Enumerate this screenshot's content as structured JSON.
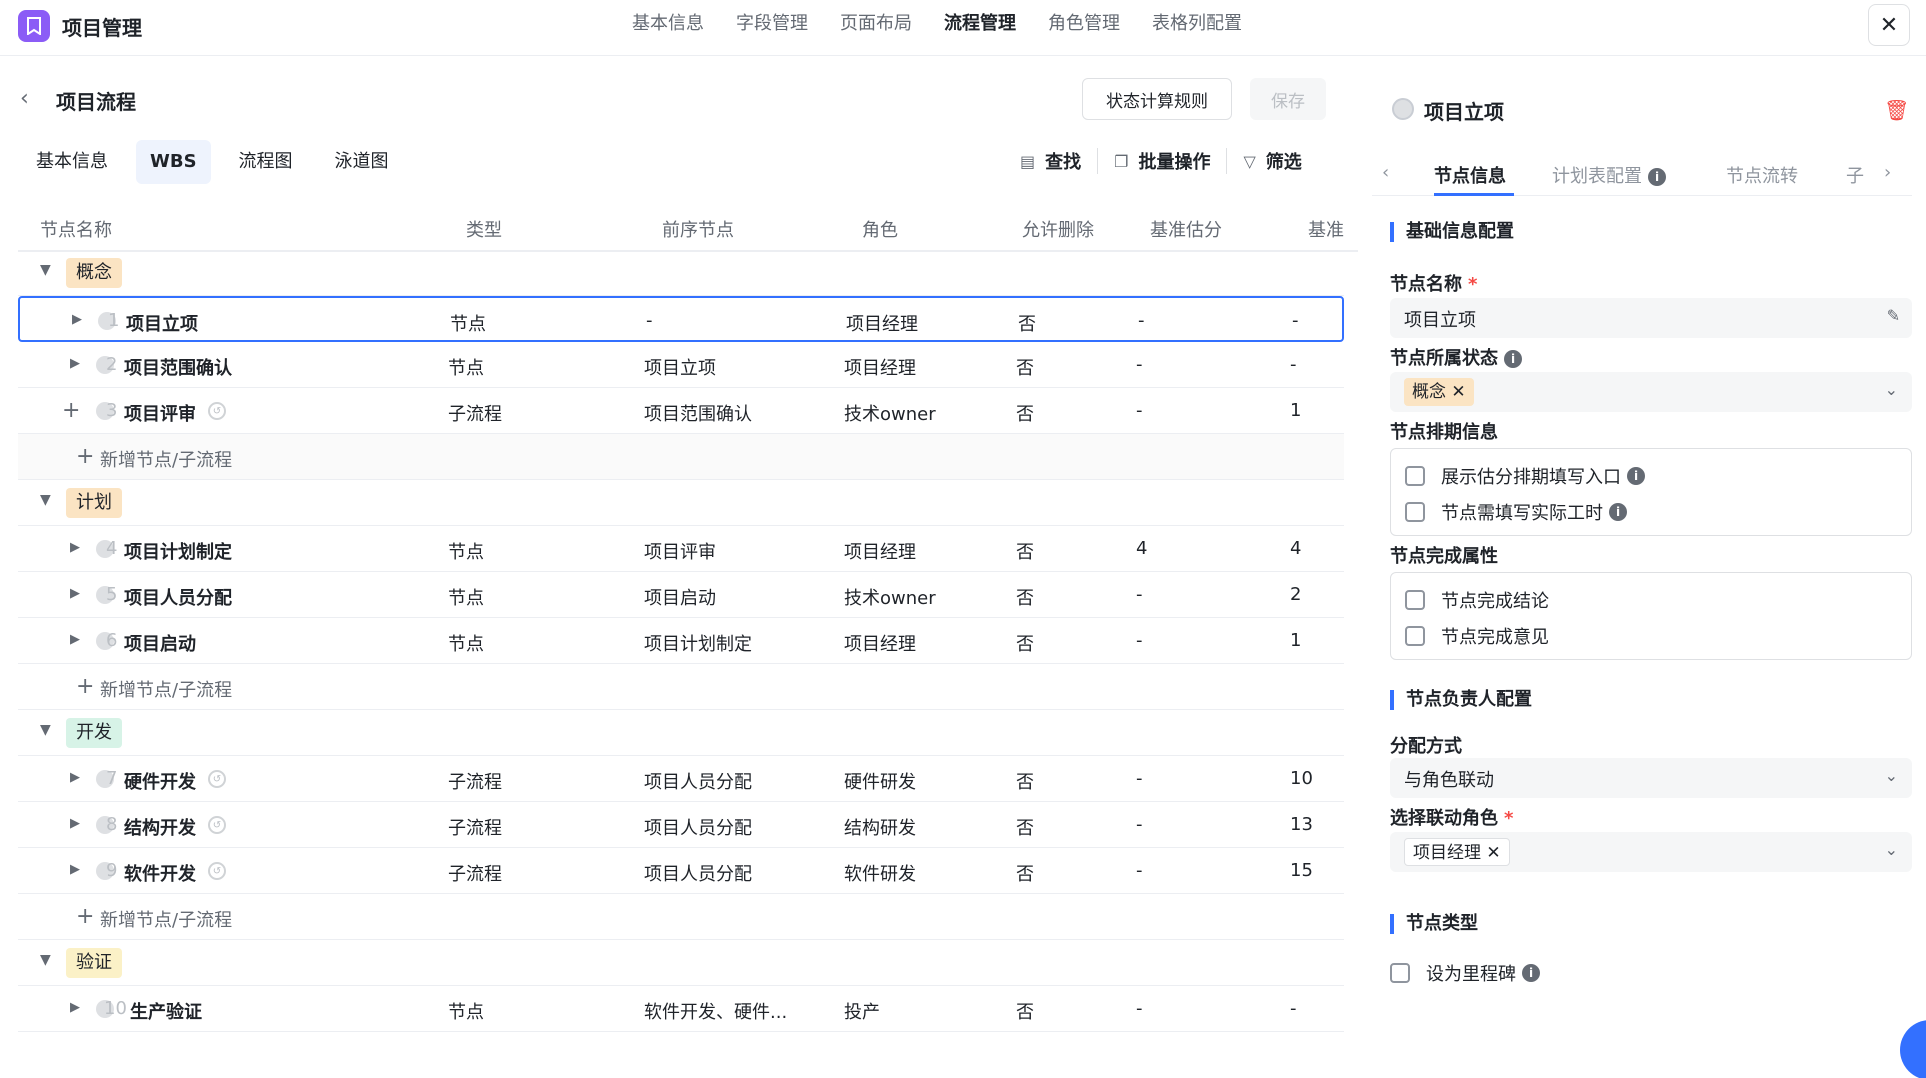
{
  "app": {
    "title": "项目管理",
    "close_label": "✕"
  },
  "topnav": [
    "基本信息",
    "字段管理",
    "页面布局",
    "流程管理",
    "角色管理",
    "表格列配置"
  ],
  "topnav_active": 3,
  "page": {
    "title": "项目流程",
    "rule_button": "状态计算规则",
    "save_button": "保存",
    "subtabs": [
      "基本信息",
      "WBS",
      "流程图",
      "泳道图"
    ],
    "subtab_active": 1,
    "tools": {
      "find": "查找",
      "batch": "批量操作",
      "filter": "筛选"
    }
  },
  "table": {
    "headers": {
      "name": "节点名称",
      "type": "类型",
      "prev": "前序节点",
      "role": "角色",
      "deletable": "允许删除",
      "estimate": "基准估分",
      "base": "基准"
    },
    "add_label": "新增节点/子流程",
    "groups": [
      {
        "label": "概念",
        "color": "#fbe4c3",
        "rows": [
          {
            "idx": "1",
            "name": "项目立项",
            "type": "节点",
            "prev": "-",
            "role": "项目经理",
            "deletable": "否",
            "estimate": "-",
            "base": "-",
            "sub": false
          },
          {
            "idx": "2",
            "name": "项目范围确认",
            "type": "节点",
            "prev": "项目立项",
            "role": "项目经理",
            "deletable": "否",
            "estimate": "-",
            "base": "-",
            "sub": false
          },
          {
            "idx": "3",
            "name": "项目评审",
            "type": "子流程",
            "prev": "项目范围确认",
            "role": "技术owner",
            "deletable": "否",
            "estimate": "-",
            "base": "1",
            "sub": true
          }
        ]
      },
      {
        "label": "计划",
        "color": "#fbe4c3",
        "rows": [
          {
            "idx": "4",
            "name": "项目计划制定",
            "type": "节点",
            "prev": "项目评审",
            "role": "项目经理",
            "deletable": "否",
            "estimate": "4",
            "base": "4",
            "sub": false
          },
          {
            "idx": "5",
            "name": "项目人员分配",
            "type": "节点",
            "prev": "项目启动",
            "role": "技术owner",
            "deletable": "否",
            "estimate": "-",
            "base": "2",
            "sub": false
          },
          {
            "idx": "6",
            "name": "项目启动",
            "type": "节点",
            "prev": "项目计划制定",
            "role": "项目经理",
            "deletable": "否",
            "estimate": "-",
            "base": "1",
            "sub": false
          }
        ]
      },
      {
        "label": "开发",
        "color": "#d7f3e7",
        "rows": [
          {
            "idx": "7",
            "name": "硬件开发",
            "type": "子流程",
            "prev": "项目人员分配",
            "role": "硬件研发",
            "deletable": "否",
            "estimate": "-",
            "base": "10",
            "sub": true
          },
          {
            "idx": "8",
            "name": "结构开发",
            "type": "子流程",
            "prev": "项目人员分配",
            "role": "结构研发",
            "deletable": "否",
            "estimate": "-",
            "base": "13",
            "sub": true
          },
          {
            "idx": "9",
            "name": "软件开发",
            "type": "子流程",
            "prev": "项目人员分配",
            "role": "软件研发",
            "deletable": "否",
            "estimate": "-",
            "base": "15",
            "sub": true
          }
        ]
      },
      {
        "label": "验证",
        "color": "#fbf1c7",
        "rows": [
          {
            "idx": "10",
            "name": "生产验证",
            "type": "节点",
            "prev": "软件开发、硬件...",
            "role": "投产",
            "deletable": "否",
            "estimate": "-",
            "base": "-",
            "sub": false
          }
        ]
      }
    ]
  },
  "panel": {
    "title": "项目立项",
    "tabs": [
      "节点信息",
      "计划表配置",
      "节点流转",
      "子"
    ],
    "basic_section": "基础信息配置",
    "name_label": "节点名称",
    "name_value": "项目立项",
    "status_label": "节点所属状态",
    "status_tag": "概念",
    "schedule_label": "节点排期信息",
    "schedule_options": [
      "展示估分排期填写入口",
      "节点需填写实际工时"
    ],
    "complete_label": "节点完成属性",
    "complete_options": [
      "节点完成结论",
      "节点完成意见"
    ],
    "owner_section": "节点负责人配置",
    "assign_label": "分配方式",
    "assign_value": "与角色联动",
    "role_label": "选择联动角色",
    "role_tag": "项目经理",
    "type_section": "节点类型",
    "milestone_label": "设为里程碑"
  },
  "colors": {
    "accent": "#3370ff",
    "danger": "#f54a45",
    "logo": "#8b5cf6"
  }
}
